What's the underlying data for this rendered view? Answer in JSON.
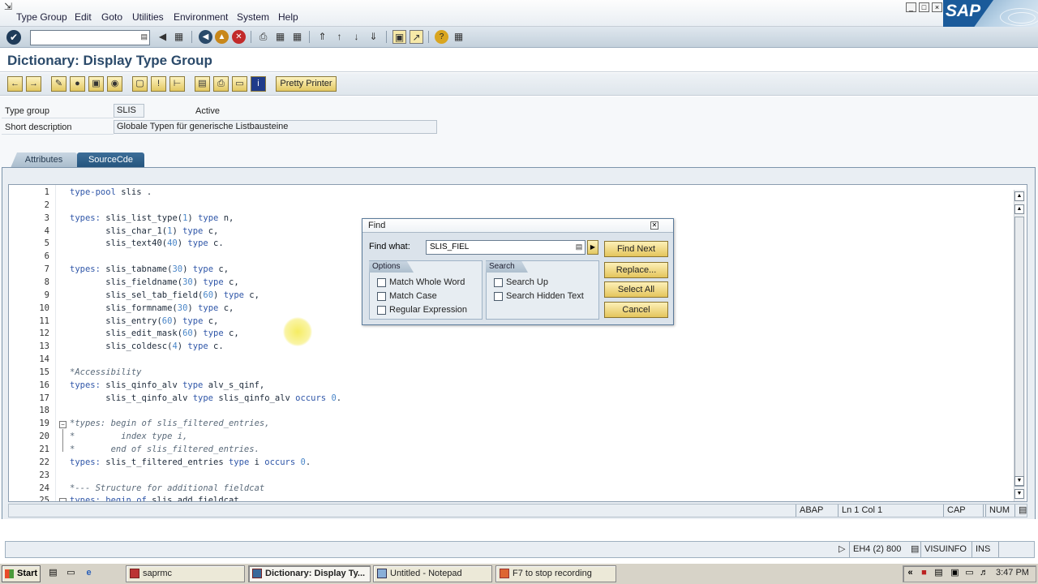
{
  "window": {
    "menu": [
      "Type Group",
      "Edit",
      "Goto",
      "Utilities",
      "Environment",
      "System",
      "Help"
    ],
    "controls": [
      "_",
      "□",
      "×"
    ],
    "logo_text": "SAP"
  },
  "page": {
    "title": "Dictionary: Display Type Group"
  },
  "toolbar2": {
    "pretty_printer": "Pretty Printer"
  },
  "header_fields": {
    "type_group_label": "Type group",
    "type_group_value": "SLIS",
    "status": "Active",
    "short_desc_label": "Short description",
    "short_desc_value": "Globale Typen für generische Listbausteine"
  },
  "tabs": [
    "Attributes",
    "SourceCde"
  ],
  "code_lines": [
    {
      "n": "1",
      "t": "type-pool slis ."
    },
    {
      "n": "2",
      "t": ""
    },
    {
      "n": "3",
      "t": "types: slis_list_type(1) type n,"
    },
    {
      "n": "4",
      "t": "       slis_char_1(1) type c,"
    },
    {
      "n": "5",
      "t": "       slis_text40(40) type c."
    },
    {
      "n": "6",
      "t": ""
    },
    {
      "n": "7",
      "t": "types: slis_tabname(30) type c,"
    },
    {
      "n": "8",
      "t": "       slis_fieldname(30) type c,"
    },
    {
      "n": "9",
      "t": "       slis_sel_tab_field(60) type c,"
    },
    {
      "n": "10",
      "t": "       slis_formname(30) type c,"
    },
    {
      "n": "11",
      "t": "       slis_entry(60) type c,"
    },
    {
      "n": "12",
      "t": "       slis_edit_mask(60) type c,"
    },
    {
      "n": "13",
      "t": "       slis_coldesc(4) type c."
    },
    {
      "n": "14",
      "t": ""
    },
    {
      "n": "15",
      "t": "*Accessibility"
    },
    {
      "n": "16",
      "t": "types: slis_qinfo_alv type alv_s_qinf,"
    },
    {
      "n": "17",
      "t": "       slis_t_qinfo_alv type slis_qinfo_alv occurs 0."
    },
    {
      "n": "18",
      "t": ""
    },
    {
      "n": "19",
      "t": "*types: begin of slis_filtered_entries,"
    },
    {
      "n": "20",
      "t": "*         index type i,"
    },
    {
      "n": "21",
      "t": "*       end of slis_filtered_entries."
    },
    {
      "n": "22",
      "t": "types: slis_t_filtered_entries type i occurs 0."
    },
    {
      "n": "23",
      "t": ""
    },
    {
      "n": "24",
      "t": "*--- Structure for additional fieldcat"
    },
    {
      "n": "25",
      "t": "types: begin of slis_add_fieldcat,"
    }
  ],
  "editor_status": {
    "lang": "ABAP",
    "position": "Ln  1 Col  1",
    "caps": "CAP",
    "num": "NUM"
  },
  "find_dialog": {
    "title": "Find",
    "find_what_label": "Find what:",
    "find_what_value": "SLIS_FIEL",
    "options_label": "Options",
    "search_label": "Search",
    "options": [
      "Match Whole Word",
      "Match Case",
      "Regular Expression"
    ],
    "search_options": [
      "Search Up",
      "Search Hidden Text"
    ],
    "buttons": [
      "Find Next",
      "Replace...",
      "Select All",
      "Cancel"
    ]
  },
  "status_bar": {
    "system": "EH4 (2) 800",
    "server": "VISUINFO",
    "mode": "INS"
  },
  "taskbar": {
    "start": "Start",
    "tasks": [
      "saprmc",
      "Dictionary: Display Ty...",
      "Untitled - Notepad",
      "F7 to stop recording"
    ],
    "clock": "3:47 PM"
  }
}
